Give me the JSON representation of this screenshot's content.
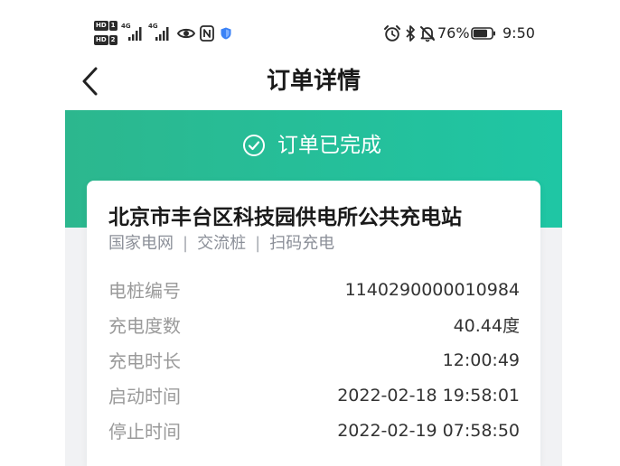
{
  "status_bar": {
    "sim_badges": [
      {
        "label": "HD",
        "num": "1"
      },
      {
        "label": "HD",
        "num": "2"
      }
    ],
    "signals": [
      {
        "type": "4G"
      },
      {
        "type": "4G"
      }
    ],
    "left_icons": [
      "eye-icon",
      "nfc-icon",
      "shield-icon"
    ],
    "right_icons": [
      "alarm-icon",
      "bluetooth-icon",
      "mute-icon",
      "battery-icon"
    ],
    "battery_percent_text": "76%",
    "battery_level": 0.76,
    "time": "9:50"
  },
  "header": {
    "back_icon": "chevron-left-icon",
    "title": "订单详情"
  },
  "banner": {
    "icon": "check-circle-icon",
    "status_text": "订单已完成"
  },
  "station": {
    "name": "北京市丰台区科技园供电所公共充电站",
    "tags": [
      "国家电网",
      "交流桩",
      "扫码充电"
    ],
    "separator": "|"
  },
  "details": [
    {
      "label": "电桩编号",
      "value": "1140290000010984"
    },
    {
      "label": "充电度数",
      "value": "40.44度"
    },
    {
      "label": "充电时长",
      "value": "12:00:49"
    },
    {
      "label": "启动时间",
      "value": "2022-02-18 19:58:01"
    },
    {
      "label": "停止时间",
      "value": "2022-02-19 07:58:50"
    }
  ],
  "colors": {
    "banner_start": "#2cb78e",
    "banner_end": "#1fc6a4",
    "page_bg": "#f1f2f4",
    "label": "#9a9a9a",
    "value": "#333333",
    "shield": "#3b82f6"
  }
}
